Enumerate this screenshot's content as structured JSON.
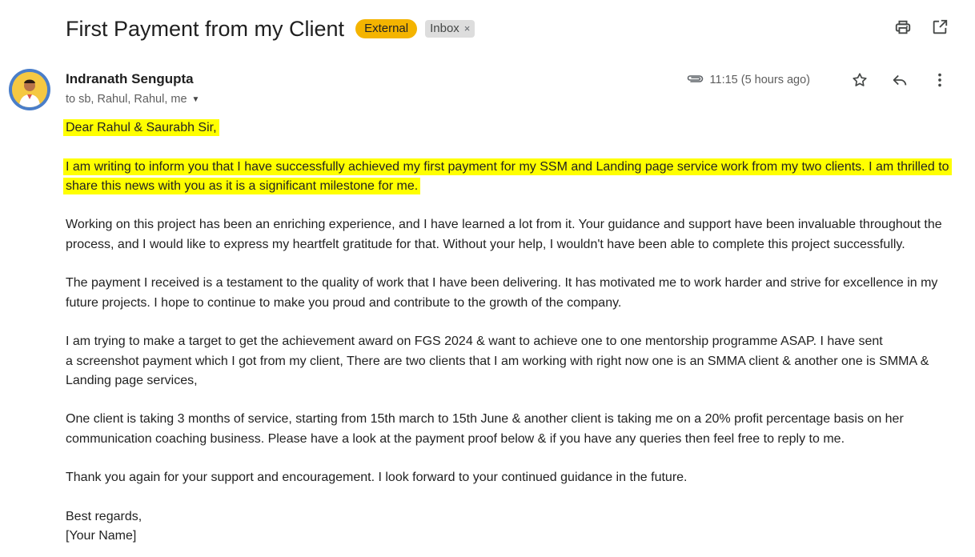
{
  "subject": "First Payment from my Client",
  "labels": {
    "external": "External",
    "inbox": "Inbox",
    "remove_label": "×"
  },
  "icons": {
    "print": "print-icon",
    "open_new_window": "open-in-new-window-icon",
    "attachment": "paperclip-icon",
    "star": "star-icon",
    "reply": "reply-icon",
    "more": "more-vertical-icon",
    "caret": "chevron-down-icon"
  },
  "sender": {
    "name": "Indranath Sengupta",
    "recipients": "to sb, Rahul, Rahul, me"
  },
  "timestamp": "11:15 (5 hours ago)",
  "body": {
    "greeting": "Dear Rahul & Saurabh Sir,",
    "p1": "I am writing to inform you that I have successfully achieved my first payment for my SSM and Landing page service work from my two clients. I am thrilled to share this news with you as it is a significant milestone for me.",
    "p2": "Working on this project has been an enriching experience, and I have learned a lot from it. Your guidance and support have been invaluable throughout the process, and I would like to express my heartfelt gratitude for that. Without your help, I wouldn't have been able to complete this project successfully.",
    "p3": "The payment I received is a testament to the quality of work that I have been delivering. It has motivated me to work harder and strive for excellence in my future projects. I hope to continue to make you proud and contribute to the growth of the company.",
    "p4_line1": "I am trying to make a target to get the achievement award on FGS 2024 & want to achieve one to one mentorship programme ASAP. I have sent",
    "p4_rest": "a screenshot payment which I got from my client, There are two clients that I am working with right now one is an SMMA client & another one is SMMA & Landing page services,",
    "p5": "One client is taking 3 months of service, starting from 15th march to 15th June & another client is taking me on a 20% profit percentage basis on her communication coaching business. Please have a look at the payment proof below & if you have any queries then feel free to reply to me.",
    "p6": "Thank you again for your support and encouragement. I look forward to your continued guidance in the future.",
    "closing": "Best regards,",
    "signature": "[Your Name]"
  },
  "colors": {
    "highlight": "#ffff00",
    "external_badge": "#f4b400",
    "inbox_badge": "#dddddd"
  }
}
